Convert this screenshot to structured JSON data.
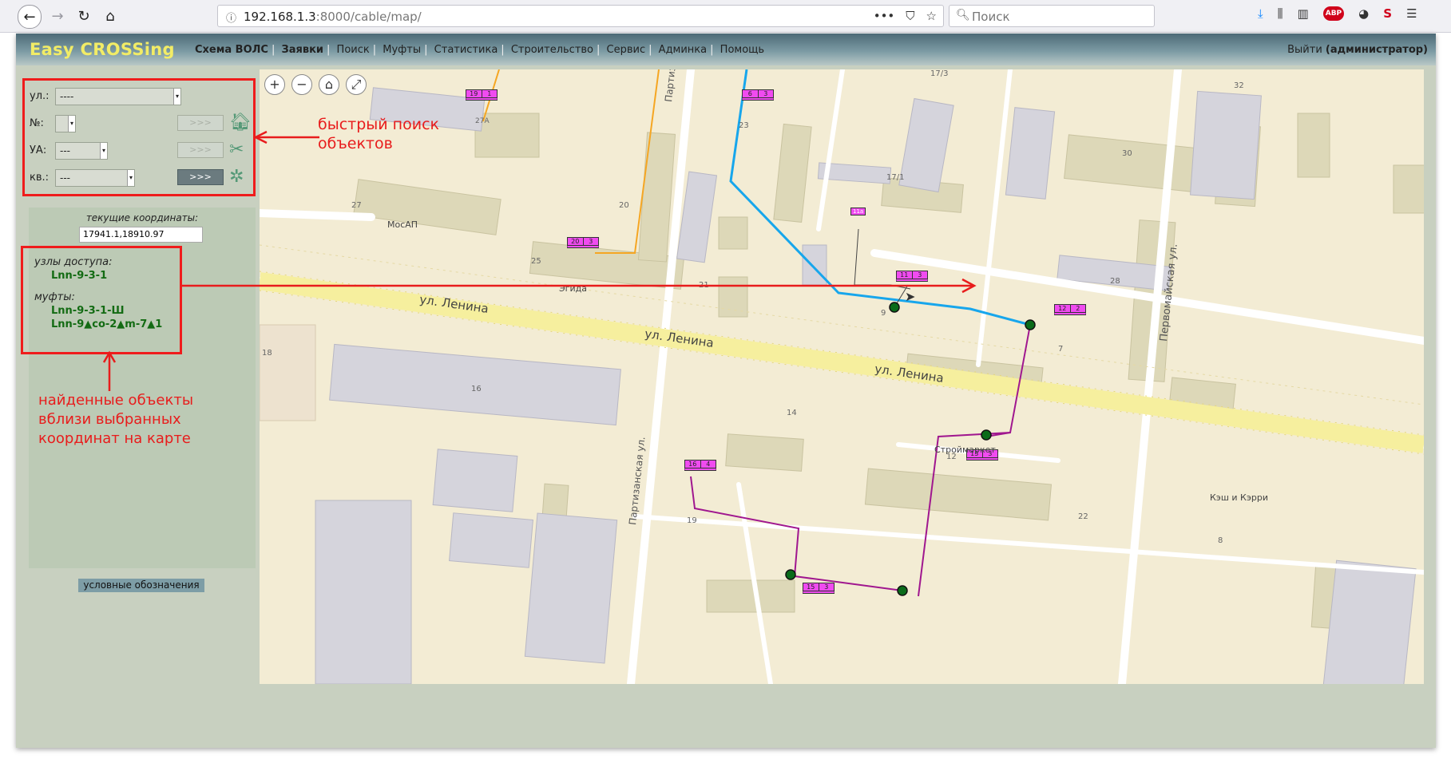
{
  "browser": {
    "url_host": "192.168.1.3",
    "url_rest": ":8000/cable/map/",
    "url_more": "•••",
    "search_placeholder": "Поиск"
  },
  "app": {
    "logo": "Easy CROSSing",
    "menu": [
      "Схема ВОЛС",
      "Заявки",
      "Поиск",
      "Муфты",
      "Статистика",
      "Строительство",
      "Сервис",
      "Админка",
      "Помощь"
    ],
    "logout_prefix": "Выйти",
    "logout_user": "(администратор)"
  },
  "search": {
    "street_label": "ул.:",
    "street_value": "----",
    "number_label": "№:",
    "number_value": "",
    "node_label": "УА:",
    "node_value": "---",
    "apt_label": "кв.:",
    "apt_value": "---",
    "go_label": ">>>"
  },
  "coords": {
    "title": "текущие координаты:",
    "value": "17941.1,18910.97"
  },
  "found": {
    "nodes_heading": "узлы доступа:",
    "nodes": [
      "Lnn-9-3-1"
    ],
    "couplings_heading": "муфты:",
    "couplings": [
      "Lnn-9-3-1-Ш",
      "Lnn-9▲co-2▲m-7▲1"
    ]
  },
  "annotations": {
    "quick_search": [
      "быстрый поиск",
      "объектов"
    ],
    "found_objects": [
      "найденные объекты",
      "вблизи выбранных",
      "координат на карте"
    ]
  },
  "legend_button": "условные обозначения",
  "map": {
    "zoom_in": "+",
    "zoom_out": "−",
    "home": "⌂",
    "fit": "⤢",
    "streets": [
      "ул. Ленина",
      "ул. Ленина",
      "ул. Ленина",
      "Партизанская",
      "Партизанская ул.",
      "Первомайская ул."
    ],
    "pois": [
      "МосАП",
      "Эгида",
      "Строймаркет",
      "Кэш и Кэрри"
    ],
    "house_numbers": [
      "27А",
      "23",
      "32",
      "30",
      "17/3",
      "17/1",
      "27",
      "20",
      "25",
      "21",
      "9",
      "7",
      "28",
      "18",
      "16",
      "14",
      "12",
      "22",
      "8",
      "19",
      "11а"
    ],
    "cabinets": [
      {
        "a": "19",
        "b": "1"
      },
      {
        "a": "6",
        "b": "3"
      },
      {
        "a": "20",
        "b": "3"
      },
      {
        "a": "11",
        "b": "3"
      },
      {
        "a": "12",
        "b": "2"
      },
      {
        "a": "13",
        "b": "3"
      },
      {
        "a": "16",
        "b": "4"
      },
      {
        "a": "15",
        "b": "3"
      }
    ],
    "colors": {
      "blue_cable": "#17a6ec",
      "orange_cable": "#f5a623",
      "purple_cable": "#a0178f",
      "cabinet": "#f04bf0",
      "node": "#0a6b1a"
    }
  }
}
